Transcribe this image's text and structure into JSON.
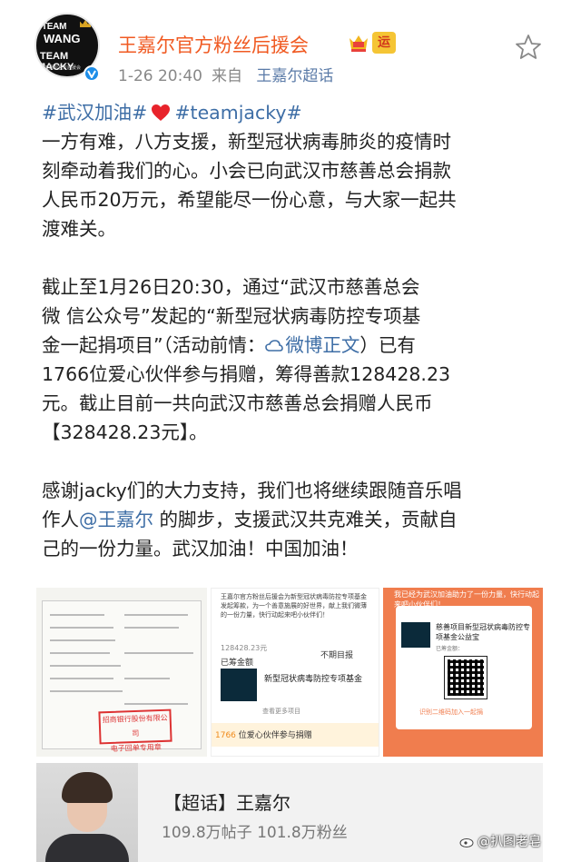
{
  "header": {
    "account_name": "王嘉尔官方粉丝后援会",
    "fan_badge": "运",
    "time": "1-26 20:40",
    "source_prefix": "来自",
    "source": "王嘉尔超话",
    "avatar_text": {
      "team_top": "TEAM",
      "wang": "WANG",
      "team_jacky": "TEAM JACKY",
      "sub": "王嘉尔官方后援会"
    }
  },
  "post": {
    "tag1": "#武汉加油#",
    "tag2": "#teamjacky#",
    "p1": [
      "一方有难，八方支援，新型冠状病毒肺炎的疫情时",
      "刻牵动着我们的心。小会已向武汉市慈善总会捐款",
      "人民币20万元，希望能尽一份心意，与大家一起共",
      "渡难关。"
    ],
    "p2_l1": "截止至1月26日20:30，通过“武汉市慈善总会",
    "p2_l2": "微 信公众号”发起的“新型冠状病毒防控专项基",
    "p2_l3_a": "金一起捐项目”（活动前情：",
    "p2_l3_link": "微博正文",
    "p2_l3_b": "）已有",
    "p2_l4": "1766位爱心伙伴参与捐赠，筹得善款128428.23",
    "p2_l5": "元。截止目前一共向武汉市慈善总会捐赠人民币",
    "p2_l6": "【328428.23元】。",
    "p3_l1": "感谢jacky们的大力支持，我们也将继续跟随音乐唱",
    "p3_l2_a": "作人",
    "p3_l2_mention": "@王嘉尔",
    "p3_l2_b": " 的脚步，支援武汉共克难关，贡献自",
    "p3_l3": "己的一份力量。武汉加油！中国加油！"
  },
  "gallery": {
    "img2": {
      "header": "王嘉尔官方粉丝后援会为新型冠状病毒防控专项基金发起筹款，为一个善意施展的好世界，献上我们微薄的一份力量，快行动起来吧小伙伴们！",
      "amount": "128428.23元",
      "done": "已筹金额",
      "report": "不期目报",
      "project": "新型冠状病毒防控专项基金",
      "more": "查看更多项目",
      "count": "1766",
      "count_text": "位爱心伙伴参与捐赠"
    },
    "img3": {
      "top": "我已经为武汉加油助力了一份力量，快行动起来吧小伙伴们！",
      "title": "慈善项目新型冠状病毒防控专项基金公益宝",
      "sub": "已筹金额：",
      "foot": "识别二维码加入一起捐"
    },
    "img1": {
      "stamp_line1": "招商银行股份有限公司",
      "stamp_line2": "电子回单专用章"
    }
  },
  "supertopic": {
    "title": "【超话】王嘉尔",
    "stats": "109.8万帖子 101.8万粉丝"
  },
  "watermark": "@扒图老皂"
}
